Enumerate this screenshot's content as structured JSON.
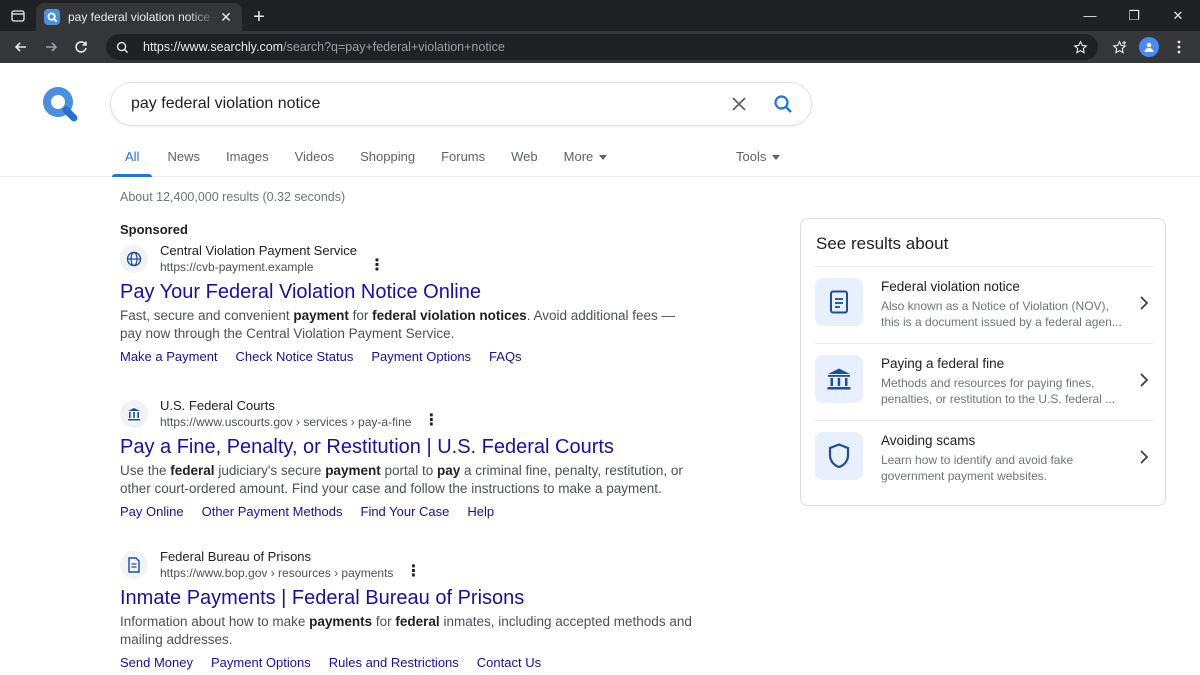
{
  "browser": {
    "tab_title": "pay federal violation notice - Searchly",
    "url_host": "https://www.searchly.com",
    "url_rest": "/search?q=pay+federal+violation+notice"
  },
  "search": {
    "query": "pay federal violation notice",
    "tabs": [
      "All",
      "News",
      "Images",
      "Videos",
      "Shopping",
      "Forums",
      "Web",
      "More"
    ],
    "active_tab": "All",
    "tools_label": "Tools",
    "stats": "About 12,400,000 results (0.32 seconds)",
    "sponsored_label": "Sponsored"
  },
  "results": [
    {
      "source_name": "Central Violation Payment Service",
      "source_url": "https://cvb-payment.example",
      "title": "Pay Your Federal Violation Notice Online",
      "desc_html_parts": [
        "Fast, secure and convenient ",
        "payment",
        " for ",
        "federal violation notices",
        ". Avoid additional fees — pay now through the Central Violation Payment Service."
      ],
      "sitelinks": [
        "Make a Payment",
        "Check Notice Status",
        "Payment Options",
        "FAQs"
      ],
      "icon": "globe-icon"
    },
    {
      "source_name": "U.S. Federal Courts",
      "source_url": "https://www.uscourts.gov › services › pay-a-fine",
      "title": "Pay a Fine, Penalty, or Restitution | U.S. Federal Courts",
      "desc_html_parts": [
        "Use the ",
        "federal",
        " judiciary's secure ",
        "payment",
        " portal to ",
        "pay",
        " a criminal fine, penalty, restitution, or other court-ordered amount. Find your case and follow the instructions to make a payment."
      ],
      "sitelinks": [
        "Pay Online",
        "Other Payment Methods",
        "Find Your Case",
        "Help"
      ],
      "icon": "courthouse-icon"
    },
    {
      "source_name": "Federal Bureau of Prisons",
      "source_url": "https://www.bop.gov › resources › payments",
      "title": "Inmate Payments | Federal Bureau of Prisons",
      "desc_html_parts": [
        "Information about how to make ",
        "payments",
        " for ",
        "federal",
        " inmates, including accepted methods and mailing addresses."
      ],
      "sitelinks": [
        "Send Money",
        "Payment Options",
        "Rules and Restrictions",
        "Contact Us"
      ],
      "icon": "document-icon"
    }
  ],
  "panel": {
    "title": "See results about",
    "items": [
      {
        "heading": "Federal violation notice",
        "desc": "Also known as a Notice of Violation (NOV), this is a document issued by a federal agen...",
        "icon": "document-icon"
      },
      {
        "heading": "Paying a federal fine",
        "desc": "Methods and resources for paying fines, penalties, or restitution to the U.S. federal ...",
        "icon": "bank-icon"
      },
      {
        "heading": "Avoiding scams",
        "desc": "Learn how to identify and avoid fake government payment websites.",
        "icon": "shield-icon"
      }
    ]
  },
  "colors": {
    "link": "#1a0dab",
    "accent": "#1a73e8",
    "chrome_dark": "#202124"
  }
}
